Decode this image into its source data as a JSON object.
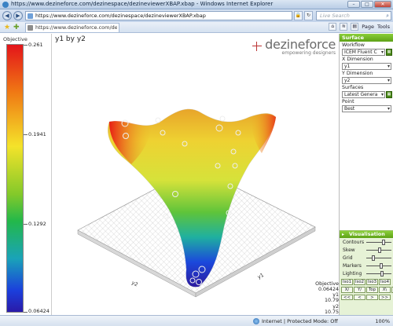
{
  "window": {
    "title": "https://www.dezineforce.com/dezinespace/dezineviewerXBAP.xbap - Windows Internet Explorer"
  },
  "address_bar": {
    "url": "https://www.dezineforce.com/dezinespace/dezineviewerXBAP.xbap",
    "search_placeholder": "Live Search"
  },
  "tab": {
    "label": "https://www.dezineforce.com/dezinesp..."
  },
  "command_bar": {
    "page_label": "Page",
    "tools_label": "Tools"
  },
  "legend": {
    "title": "Objective",
    "ticks": [
      "0.261",
      "0.1941",
      "0.1292",
      "0.06424"
    ],
    "colors": [
      "#e3141a",
      "#f07a14",
      "#f4e32a",
      "#83c92a",
      "#23b84a",
      "#1aa3b8",
      "#1b3fdc",
      "#2a1aa8"
    ]
  },
  "plot": {
    "title": "y1 by y2",
    "axis_labels": [
      "y2",
      "y1"
    ],
    "readout": {
      "objective_label": "Objective",
      "objective_value": "0.06424",
      "y1_label": "y1",
      "y1_value": "10.79",
      "y2_label": "y2",
      "y2_value": "10.75"
    }
  },
  "brand": {
    "name": "dezineforce",
    "tagline": "empowering designers"
  },
  "surface_panel": {
    "header": "Surface",
    "workflow_label": "Workflow",
    "workflow_value": "ICEM Fluent C",
    "x_dimension_label": "X Dimension",
    "x_dimension_value": "y1",
    "y_dimension_label": "Y Dimension",
    "y_dimension_value": "y2",
    "surfaces_label": "Surfaces",
    "surfaces_value": "Latest Genera",
    "point_label": "Point",
    "point_value": "Best"
  },
  "visualisation_panel": {
    "header": "Visualisation",
    "sliders": [
      {
        "label": "Contours",
        "level": 0.7
      },
      {
        "label": "Skew",
        "level": 0.55
      },
      {
        "label": "Grid",
        "level": 0.25
      },
      {
        "label": "Markers",
        "level": 0.6
      },
      {
        "label": "Lighting",
        "level": 0.65
      }
    ],
    "iso_buttons": [
      "Iso1",
      "Iso2",
      "Iso3",
      "Iso4"
    ],
    "view_buttons": [
      "X/",
      "Y/",
      "Top",
      "X\\",
      "Y\\"
    ],
    "arrow_buttons": [
      "<<",
      "<",
      ">",
      ">>"
    ]
  },
  "status_bar": {
    "zone_text": "Internet | Protected Mode: Off",
    "zoom": "100%"
  }
}
